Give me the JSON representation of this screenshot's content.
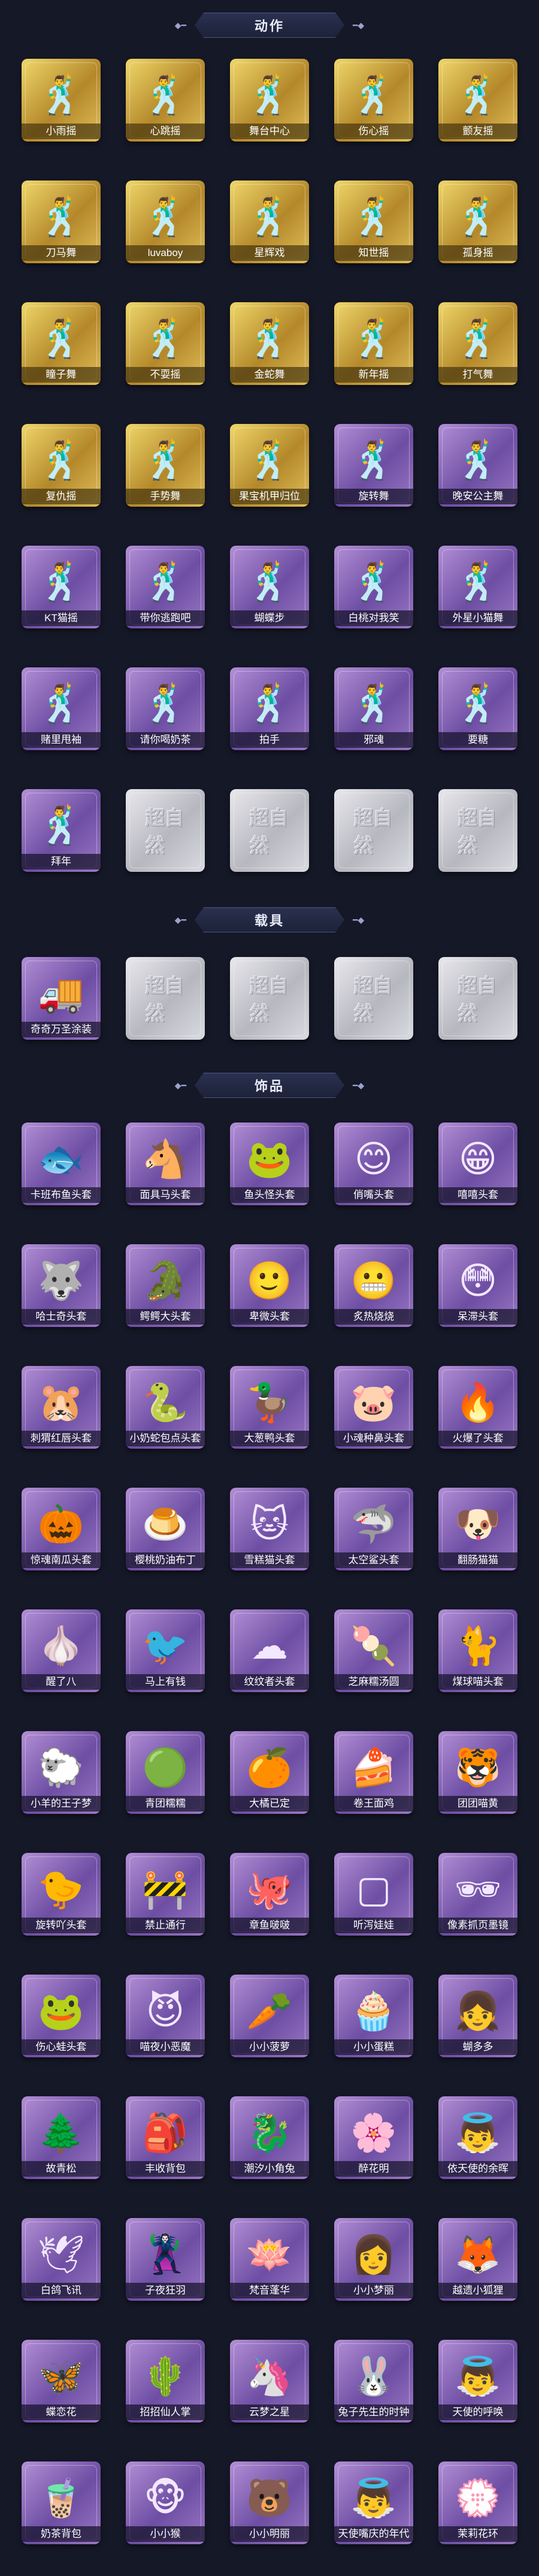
{
  "sections": {
    "actions": {
      "title": "动作",
      "items": [
        {
          "label": "小雨摇",
          "rarity": "gold",
          "icon": "dance-pose-icon"
        },
        {
          "label": "心跳摇",
          "rarity": "gold",
          "icon": "dance-pose-icon"
        },
        {
          "label": "舞台中心",
          "rarity": "gold",
          "icon": "dance-pose-icon"
        },
        {
          "label": "伤心摇",
          "rarity": "gold",
          "icon": "dance-pose-icon"
        },
        {
          "label": "颤友摇",
          "rarity": "gold",
          "icon": "dance-pose-icon"
        },
        {
          "label": "刀马舞",
          "rarity": "gold",
          "icon": "dance-pose-icon"
        },
        {
          "label": "luvaboy",
          "rarity": "gold",
          "icon": "dance-pose-icon"
        },
        {
          "label": "星辉戏",
          "rarity": "gold",
          "icon": "dance-pose-icon"
        },
        {
          "label": "知世摇",
          "rarity": "gold",
          "icon": "dance-pose-icon"
        },
        {
          "label": "孤身摇",
          "rarity": "gold",
          "icon": "dance-pose-icon"
        },
        {
          "label": "瞳子舞",
          "rarity": "gold",
          "icon": "dance-pose-icon"
        },
        {
          "label": "不耍摇",
          "rarity": "gold",
          "icon": "dance-pose-icon"
        },
        {
          "label": "金蛇舞",
          "rarity": "gold",
          "icon": "dance-pose-icon"
        },
        {
          "label": "新年摇",
          "rarity": "gold",
          "icon": "dance-pose-icon"
        },
        {
          "label": "打气舞",
          "rarity": "gold",
          "icon": "dance-pose-icon"
        },
        {
          "label": "复仇摇",
          "rarity": "gold",
          "icon": "dance-pose-icon"
        },
        {
          "label": "手势舞",
          "rarity": "gold",
          "icon": "dance-pose-icon"
        },
        {
          "label": "果宝机甲归位",
          "rarity": "gold",
          "icon": "dance-pose-icon"
        },
        {
          "label": "旋转舞",
          "rarity": "purple",
          "icon": "dance-pose-icon"
        },
        {
          "label": "晚安公主舞",
          "rarity": "purple",
          "icon": "dance-pose-icon"
        },
        {
          "label": "KT猫摇",
          "rarity": "purple",
          "icon": "dance-pose-icon"
        },
        {
          "label": "带你逃跑吧",
          "rarity": "purple",
          "icon": "dance-pose-icon"
        },
        {
          "label": "蝴蝶步",
          "rarity": "purple",
          "icon": "dance-pose-icon"
        },
        {
          "label": "白桃对我笑",
          "rarity": "purple",
          "icon": "dance-pose-icon"
        },
        {
          "label": "外星小猫舞",
          "rarity": "purple",
          "icon": "dance-pose-icon"
        },
        {
          "label": "赌里甩袖",
          "rarity": "purple",
          "icon": "dance-pose-icon"
        },
        {
          "label": "请你喝奶茶",
          "rarity": "purple",
          "icon": "dance-pose-icon"
        },
        {
          "label": "拍手",
          "rarity": "purple",
          "icon": "dance-pose-icon"
        },
        {
          "label": "邪魂",
          "rarity": "purple",
          "icon": "dance-pose-icon"
        },
        {
          "label": "要糖",
          "rarity": "purple",
          "icon": "dance-pose-icon"
        },
        {
          "label": "拜年",
          "rarity": "purple",
          "icon": "dance-pose-icon"
        },
        {
          "label": "",
          "rarity": "silver",
          "icon": "placeholder-logo-icon",
          "placeholder": "超自然"
        },
        {
          "label": "",
          "rarity": "silver",
          "icon": "placeholder-logo-icon",
          "placeholder": "超自然"
        },
        {
          "label": "",
          "rarity": "silver",
          "icon": "placeholder-logo-icon",
          "placeholder": "超自然"
        },
        {
          "label": "",
          "rarity": "silver",
          "icon": "placeholder-logo-icon",
          "placeholder": "超自然"
        }
      ]
    },
    "vehicles": {
      "title": "载具",
      "items": [
        {
          "label": "奇奇万圣涂装",
          "rarity": "purple",
          "icon": "truck-icon"
        },
        {
          "label": "",
          "rarity": "silver",
          "icon": "placeholder-logo-icon",
          "placeholder": "超自然"
        },
        {
          "label": "",
          "rarity": "silver",
          "icon": "placeholder-logo-icon",
          "placeholder": "超自然"
        },
        {
          "label": "",
          "rarity": "silver",
          "icon": "placeholder-logo-icon",
          "placeholder": "超自然"
        },
        {
          "label": "",
          "rarity": "silver",
          "icon": "placeholder-logo-icon",
          "placeholder": "超自然"
        }
      ]
    },
    "accessories": {
      "title": "饰品",
      "items": [
        {
          "label": "卡班布鱼头套",
          "rarity": "purple",
          "icon": "fish-head-icon"
        },
        {
          "label": "面具马头套",
          "rarity": "purple",
          "icon": "horse-head-icon"
        },
        {
          "label": "鱼头怪头套",
          "rarity": "purple",
          "icon": "fish-monster-icon"
        },
        {
          "label": "俏嘴头套",
          "rarity": "purple",
          "icon": "smile-face-icon"
        },
        {
          "label": "嘻嘻头套",
          "rarity": "purple",
          "icon": "grin-face-icon"
        },
        {
          "label": "哈士奇头套",
          "rarity": "purple",
          "icon": "husky-head-icon"
        },
        {
          "label": "鳄鳄大头套",
          "rarity": "purple",
          "icon": "crocodile-head-icon"
        },
        {
          "label": "卑微头套",
          "rarity": "purple",
          "icon": "shy-face-icon"
        },
        {
          "label": "炙热烧烧",
          "rarity": "purple",
          "icon": "grill-face-icon"
        },
        {
          "label": "呆滞头套",
          "rarity": "purple",
          "icon": "dazed-face-icon"
        },
        {
          "label": "刺猬红唇头套",
          "rarity": "purple",
          "icon": "pikachu-head-icon"
        },
        {
          "label": "小奶蛇包点头套",
          "rarity": "purple",
          "icon": "snake-head-icon"
        },
        {
          "label": "大葱鸭头套",
          "rarity": "purple",
          "icon": "scallion-duck-icon"
        },
        {
          "label": "小魂种鼻头套",
          "rarity": "purple",
          "icon": "pig-nose-icon"
        },
        {
          "label": "火爆了头套",
          "rarity": "purple",
          "icon": "fire-face-icon"
        },
        {
          "label": "惊魂南瓜头套",
          "rarity": "purple",
          "icon": "pumpkin-head-icon"
        },
        {
          "label": "樱桃奶油布丁",
          "rarity": "purple",
          "icon": "pudding-icon"
        },
        {
          "label": "雪糕猫头套",
          "rarity": "purple",
          "icon": "ice-cat-icon"
        },
        {
          "label": "太空鲨头套",
          "rarity": "purple",
          "icon": "space-shark-icon"
        },
        {
          "label": "翻肠猫猫",
          "rarity": "purple",
          "icon": "sausage-dog-icon"
        },
        {
          "label": "醒了八",
          "rarity": "purple",
          "icon": "garlic-icon"
        },
        {
          "label": "马上有钱",
          "rarity": "purple",
          "icon": "money-bird-icon"
        },
        {
          "label": "纹纹者头套",
          "rarity": "purple",
          "icon": "cloud-cat-icon"
        },
        {
          "label": "芝麻糯汤圆",
          "rarity": "purple",
          "icon": "rice-ball-icon"
        },
        {
          "label": "煤球喵头套",
          "rarity": "purple",
          "icon": "black-cat-icon"
        },
        {
          "label": "小羊的王子梦",
          "rarity": "purple",
          "icon": "crown-sheep-icon"
        },
        {
          "label": "青团糯糯",
          "rarity": "purple",
          "icon": "green-dumpling-icon"
        },
        {
          "label": "大橘已定",
          "rarity": "purple",
          "icon": "orange-icon"
        },
        {
          "label": "卷王面鸡",
          "rarity": "purple",
          "icon": "roll-cake-icon"
        },
        {
          "label": "团团喵黄",
          "rarity": "purple",
          "icon": "yellow-cat-icon"
        },
        {
          "label": "旋转吖头套",
          "rarity": "purple",
          "icon": "duck-head-icon"
        },
        {
          "label": "禁止通行",
          "rarity": "purple",
          "icon": "traffic-cone-icon"
        },
        {
          "label": "章鱼啵啵",
          "rarity": "purple",
          "icon": "octopus-icon"
        },
        {
          "label": "听泻娃娃",
          "rarity": "purple",
          "icon": "empty-frame-icon"
        },
        {
          "label": "像素抓页墨镜",
          "rarity": "purple",
          "icon": "pixel-sunglasses-icon"
        },
        {
          "label": "伤心蛙头套",
          "rarity": "purple",
          "icon": "sad-frog-icon"
        },
        {
          "label": "喵夜小恶魔",
          "rarity": "purple",
          "icon": "devil-cat-icon"
        },
        {
          "label": "小小菠萝",
          "rarity": "purple",
          "icon": "radish-doll-icon"
        },
        {
          "label": "小小蛋糕",
          "rarity": "purple",
          "icon": "cake-doll-icon"
        },
        {
          "label": "蝴多多",
          "rarity": "purple",
          "icon": "doll-girl-icon"
        },
        {
          "label": "故青松",
          "rarity": "purple",
          "icon": "pine-tree-icon"
        },
        {
          "label": "丰收背包",
          "rarity": "purple",
          "icon": "backpack-icon"
        },
        {
          "label": "潮汐小角兔",
          "rarity": "purple",
          "icon": "blue-creature-icon"
        },
        {
          "label": "醉花明",
          "rarity": "purple",
          "icon": "flower-fairy-icon"
        },
        {
          "label": "依天使的余晖",
          "rarity": "purple",
          "icon": "angel-doll-icon"
        },
        {
          "label": "白鸽飞讯",
          "rarity": "purple",
          "icon": "white-dove-icon"
        },
        {
          "label": "子夜狂羽",
          "rarity": "purple",
          "icon": "dark-knight-icon"
        },
        {
          "label": "梵音蓬华",
          "rarity": "purple",
          "icon": "lotus-doll-icon"
        },
        {
          "label": "小小梦丽",
          "rarity": "purple",
          "icon": "pink-girl-icon"
        },
        {
          "label": "越遗小狐狸",
          "rarity": "purple",
          "icon": "fox-doll-icon"
        },
        {
          "label": "蝶恋花",
          "rarity": "purple",
          "icon": "butterfly-icon"
        },
        {
          "label": "招招仙人掌",
          "rarity": "purple",
          "icon": "cactus-icon"
        },
        {
          "label": "云梦之星",
          "rarity": "purple",
          "icon": "unicorn-icon"
        },
        {
          "label": "兔子先生的时钟",
          "rarity": "purple",
          "icon": "clock-bunny-icon"
        },
        {
          "label": "天使的呼唤",
          "rarity": "purple",
          "icon": "angel-girl-icon"
        },
        {
          "label": "奶茶背包",
          "rarity": "purple",
          "icon": "milk-tea-bag-icon"
        },
        {
          "label": "小小猴",
          "rarity": "purple",
          "icon": "monkey-icon"
        },
        {
          "label": "小小明丽",
          "rarity": "purple",
          "icon": "bear-girl-icon"
        },
        {
          "label": "天使嘴庆的年代",
          "rarity": "purple",
          "icon": "angel-doll-icon"
        },
        {
          "label": "茉莉花环",
          "rarity": "purple",
          "icon": "jasmine-doll-icon"
        }
      ]
    }
  }
}
